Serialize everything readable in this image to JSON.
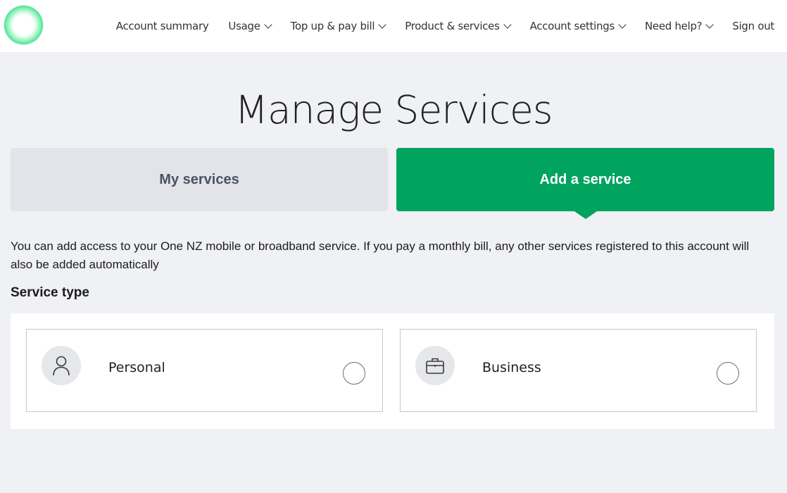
{
  "nav": {
    "items": [
      {
        "label": "Account summary",
        "has_dropdown": false
      },
      {
        "label": "Usage",
        "has_dropdown": true
      },
      {
        "label": "Top up & pay bill",
        "has_dropdown": true
      },
      {
        "label": "Product & services",
        "has_dropdown": true
      },
      {
        "label": "Account settings",
        "has_dropdown": true
      },
      {
        "label": "Need help?",
        "has_dropdown": true
      },
      {
        "label": "Sign out",
        "has_dropdown": false
      }
    ]
  },
  "page": {
    "title": "Manage Services"
  },
  "tabs": {
    "my_services": "My services",
    "add_service": "Add a service",
    "active": "add_service"
  },
  "content": {
    "intro": "You can add access to your One NZ mobile or broadband service. If you pay a monthly bill, any other services registered to this account will also be added automatically",
    "service_type_heading": "Service type",
    "options": [
      {
        "label": "Personal",
        "icon": "person-icon",
        "selected": false
      },
      {
        "label": "Business",
        "icon": "briefcase-icon",
        "selected": false
      }
    ]
  },
  "colors": {
    "brand_green": "#00a45f",
    "background": "#f0f1f5",
    "inactive_tab": "#e2e4ea"
  }
}
